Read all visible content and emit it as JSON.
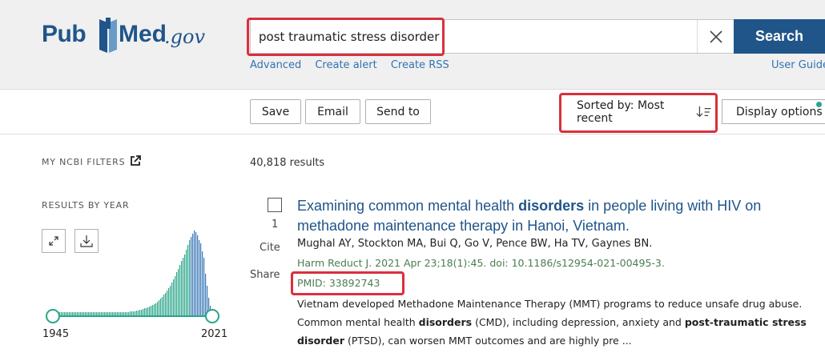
{
  "header": {
    "logo_pub": "Pub",
    "logo_med": "Med",
    "logo_gov": ".gov",
    "search_value": "post traumatic stress disorder",
    "search_button": "Search",
    "links": [
      "Advanced",
      "Create alert",
      "Create RSS"
    ],
    "user_guide": "User Guide"
  },
  "toolbar": {
    "buttons": [
      "Save",
      "Email",
      "Send to"
    ],
    "sort_label": "Sorted by: Most recent",
    "display_options": "Display options"
  },
  "sidebar": {
    "filters_label": "MY NCBI FILTERS",
    "results_by_year_label": "RESULTS BY YEAR",
    "year_min": "1945",
    "year_max": "2021"
  },
  "results": {
    "count": "40,818 results",
    "items": [
      {
        "number": "1",
        "cite": "Cite",
        "share": "Share",
        "title_parts": [
          "Examining common mental health ",
          "disorders",
          " in people living with HIV on methadone maintenance therapy in Hanoi, Vietnam."
        ],
        "authors": "Mughal AY, Stockton MA, Bui Q, Go V, Pence BW, Ha TV, Gaynes BN.",
        "journal": "Harm Reduct J. 2021 Apr 23;18(1):45. doi: 10.1186/s12954-021-00495-3.",
        "pmid": "PMID: 33892743",
        "snippet_parts": [
          "Vietnam developed Methadone Maintenance Therapy (MMT) programs to reduce unsafe drug abuse. Common mental health ",
          "disorders",
          " (CMD), including depression, anxiety and ",
          "post-traumatic stress disorder",
          " (PTSD), can worsen MMT outcomes and are highly pre ..."
        ]
      }
    ]
  },
  "colors": {
    "brand_blue": "#20558a",
    "link_blue": "#3273b0",
    "highlight_red": "#d9303d",
    "chart_teal": "#2aa58a",
    "chart_blue": "#3a78b8"
  }
}
